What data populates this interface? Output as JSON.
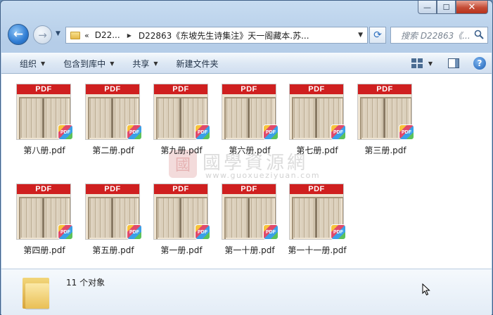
{
  "window": {
    "caption": {
      "minimize": "—",
      "maximize": "☐",
      "close": "✕"
    }
  },
  "nav": {
    "back": "←",
    "forward": "→",
    "breadcrumb_chevron": "«",
    "segments": [
      "D22...",
      "D22863《东坡先生诗集注》天一阁藏本.苏..."
    ],
    "search_placeholder": "搜索 D22863《...",
    "refresh": "⟳"
  },
  "toolbar": {
    "organize": "组织",
    "include_in_library": "包含到库中",
    "share": "共享",
    "new_folder": "新建文件夹"
  },
  "files": [
    {
      "name": "第八册.pdf",
      "badge": "PDF"
    },
    {
      "name": "第二册.pdf",
      "badge": "PDF"
    },
    {
      "name": "第九册.pdf",
      "badge": "PDF"
    },
    {
      "name": "第六册.pdf",
      "badge": "PDF"
    },
    {
      "name": "第七册.pdf",
      "badge": "PDF"
    },
    {
      "name": "第三册.pdf",
      "badge": "PDF"
    },
    {
      "name": "第四册.pdf",
      "badge": "PDF"
    },
    {
      "name": "第五册.pdf",
      "badge": "PDF"
    },
    {
      "name": "第一册.pdf",
      "badge": "PDF"
    },
    {
      "name": "第一十册.pdf",
      "badge": "PDF"
    },
    {
      "name": "第一十一册.pdf",
      "badge": "PDF"
    }
  ],
  "thumb_label": "PDF",
  "watermark": {
    "seal": "國",
    "text": "國學資源網",
    "url": "www.guoxueziyuan.com"
  },
  "details": {
    "count": "11 个对象"
  },
  "colors": {
    "pdf_band": "#cf1f1f",
    "window_frame": "#b5cde8"
  }
}
